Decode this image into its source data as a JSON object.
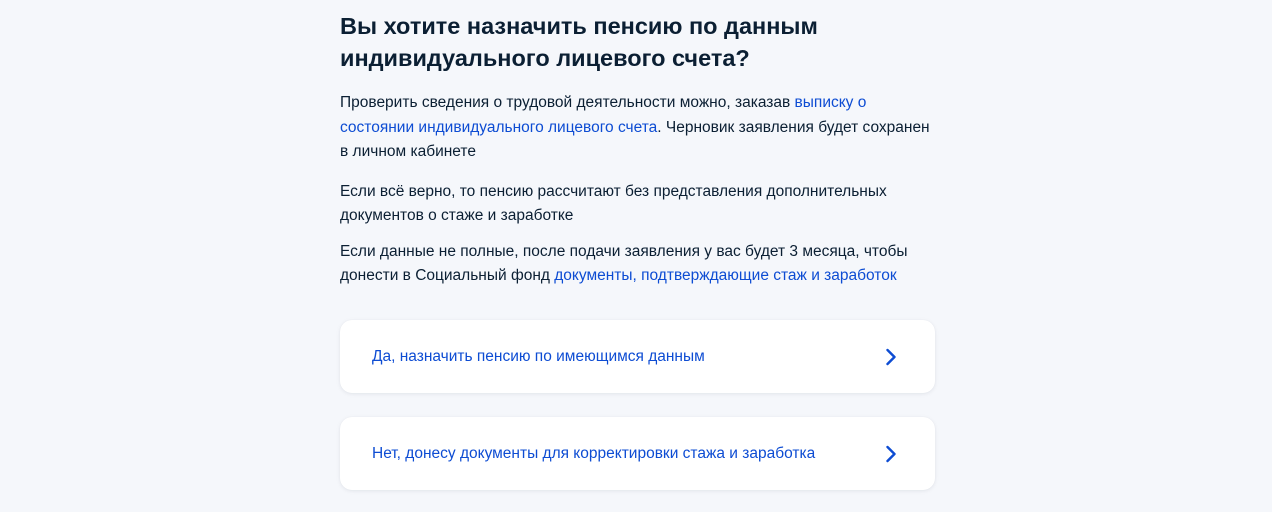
{
  "heading": {
    "line1": "Вы хотите назначить пенсию по данным",
    "line2": "индивидуального лицевого счета?"
  },
  "paragraph1": {
    "text_before": "Проверить сведения о трудовой деятельности можно, заказав ",
    "link": "выписку о состоянии индивидуального лицевого счета",
    "text_after": ". Черновик заявления будет сохранен в личном кабинете"
  },
  "paragraph2": {
    "text": "Если всё верно, то пенсию рассчитают без представления дополнительных документов о стаже и заработке"
  },
  "paragraph3": {
    "text_before": "Если данные не полные, после подачи заявления у вас будет 3 месяца, чтобы донести в Социальный фонд ",
    "link": "документы, подтверждающие стаж и заработок"
  },
  "options": [
    {
      "label": "Да, назначить пенсию по имеющимся данным",
      "icon": "chevron-right-icon"
    },
    {
      "label": "Нет, донесу документы для корректировки стажа и заработка",
      "icon": "chevron-right-icon"
    }
  ],
  "colors": {
    "background": "#f5f7fb",
    "text": "#0b1f33",
    "link": "#0d4cd3",
    "card": "#ffffff"
  }
}
